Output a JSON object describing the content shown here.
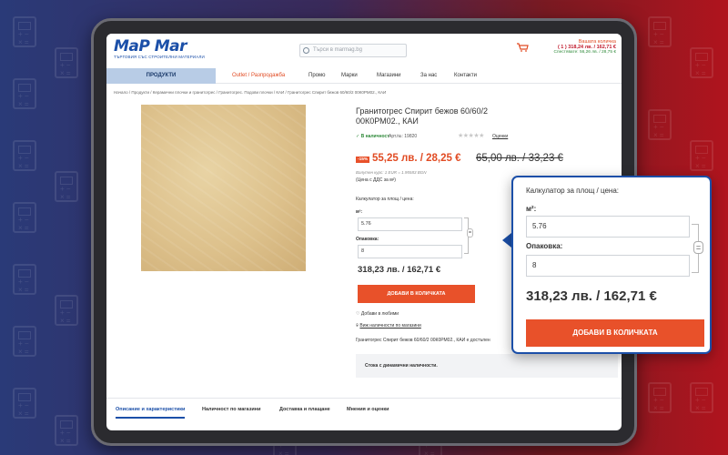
{
  "header": {
    "logo_text": "MaP Mar",
    "logo_tagline": "ТЪРГОВИЯ СЪС СТРОИТЕЛНИ МАТЕРИАЛИ",
    "search_placeholder": "Търси в marmag.bg",
    "cart_label": "Вашата количка",
    "cart_total": "( 1 ) 318,24 лв. / 162,71 €",
    "cart_savings": "Спестявате: 56,26 лв. / 28,75 €"
  },
  "nav": {
    "products": "ПРОДУКТИ",
    "items": [
      "Outlet / Разпродажба",
      "Промо",
      "Марки",
      "Магазини",
      "За нас",
      "Контакти"
    ]
  },
  "breadcrumbs": "Начало  /  Продукти  /  Керамични плочки и гранитогрес  /  Гранитогрес. Подови плочки  /  КАИ  /  Гранитогрес Спирит бежов 60/60/2 00К0РМ02., КАИ",
  "product": {
    "title": "Гранитогрес Спирит бежов 60/60/2 00К0РМ02., КАИ",
    "stock": "✓ В наличност",
    "art_no": "Арт.№: 19820",
    "reviews": "Оценки",
    "discount": "-15%",
    "price_new": "55,25 лв. / 28,25 €",
    "price_old": "65,00 лв. / 33,23 €",
    "rate": "Валутен курс: 1 EUR = 1.95583 BGN",
    "vat": "(Цена с ДДС за м²)",
    "calc_label": "Калкулатор за площ / цена:",
    "m2_label": "м²:",
    "m2_value": "5.76",
    "pack_label": "Опаковка:",
    "pack_value": "8",
    "total": "318,23 лв. / 162,71 €",
    "add_button": "ДОБАВИ В КОЛИЧКАТА",
    "favorites": "Добави в любими",
    "availability": "Виж наличности по магазини",
    "description": "Гранитогрес Спирит бежов 60/60/2 00К0РМ02., КАИ е достъпен",
    "dynamic": "Стока с динамични наличности."
  },
  "tabs": [
    "Описание и характеристики",
    "Наличност по магазини",
    "Доставка и плащане",
    "Мнения и оценки"
  ],
  "popup": {
    "calc_label": "Калкулатор за площ / цена:",
    "m2_label": "м²:",
    "m2_value": "5.76",
    "pack_label": "Опаковка:",
    "pack_value": "8",
    "equals": "=",
    "total": "318,23 лв. / 162,71 €",
    "add_button": "ДОБАВИ В КОЛИЧКАТА"
  },
  "colors": {
    "accent": "#e8512a",
    "brand": "#1b4fa8",
    "stock_green": "#2f8a3a"
  },
  "icons": [
    "search-icon",
    "cart-icon",
    "heart-icon",
    "location-pin-icon",
    "calculator-icon"
  ]
}
